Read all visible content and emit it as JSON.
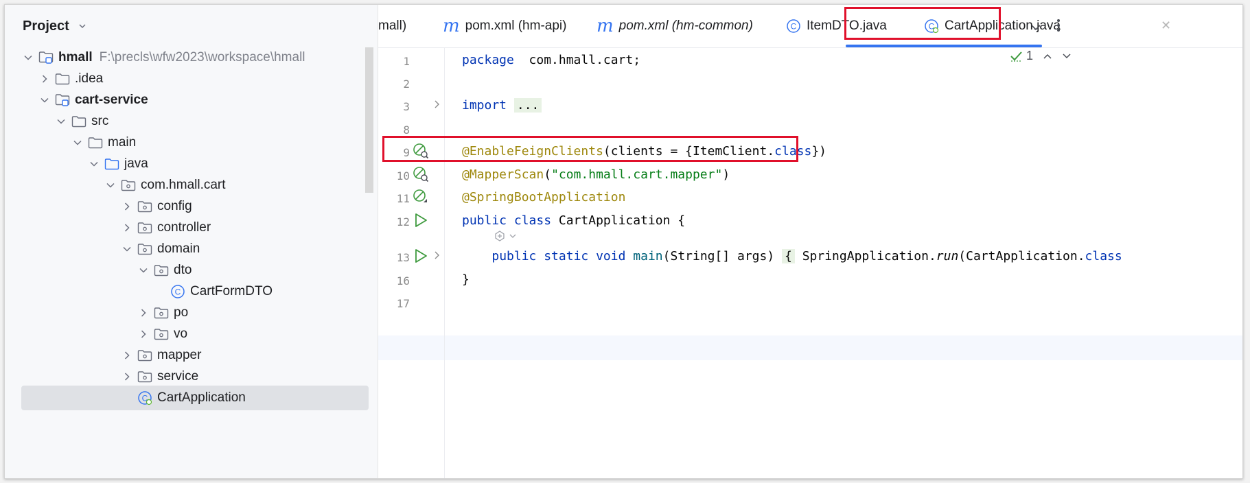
{
  "project": {
    "header": "Project",
    "tree": [
      {
        "label": "hmall",
        "path": "F:\\precls\\wfw2023\\workspace\\hmall",
        "arrow": "down",
        "icon": "module",
        "depth": 0,
        "bold": true
      },
      {
        "label": ".idea",
        "arrow": "right",
        "icon": "folder",
        "depth": 1
      },
      {
        "label": "cart-service",
        "arrow": "down",
        "icon": "module",
        "depth": 1,
        "bold": true
      },
      {
        "label": "src",
        "arrow": "down",
        "icon": "folder",
        "depth": 2
      },
      {
        "label": "main",
        "arrow": "down",
        "icon": "folder",
        "depth": 3
      },
      {
        "label": "java",
        "arrow": "down",
        "icon": "source-folder",
        "depth": 4
      },
      {
        "label": "com.hmall.cart",
        "arrow": "down",
        "icon": "package",
        "depth": 5
      },
      {
        "label": "config",
        "arrow": "right",
        "icon": "package",
        "depth": 6
      },
      {
        "label": "controller",
        "arrow": "right",
        "icon": "package",
        "depth": 6
      },
      {
        "label": "domain",
        "arrow": "down",
        "icon": "package",
        "depth": 6
      },
      {
        "label": "dto",
        "arrow": "down",
        "icon": "package",
        "depth": 7
      },
      {
        "label": "CartFormDTO",
        "arrow": "none",
        "icon": "class",
        "depth": 8
      },
      {
        "label": "po",
        "arrow": "right",
        "icon": "package",
        "depth": 7
      },
      {
        "label": "vo",
        "arrow": "right",
        "icon": "package",
        "depth": 7
      },
      {
        "label": "mapper",
        "arrow": "right",
        "icon": "package",
        "depth": 6
      },
      {
        "label": "service",
        "arrow": "right",
        "icon": "package",
        "depth": 6
      },
      {
        "label": "CartApplication",
        "arrow": "none",
        "icon": "spring-class",
        "depth": 6,
        "selected": true
      }
    ]
  },
  "tabs": [
    {
      "label": "mall)",
      "icon": "none"
    },
    {
      "label": "pom.xml (hm-api)",
      "icon": "m"
    },
    {
      "label": "pom.xml (hm-common)",
      "icon": "m",
      "italic": true
    },
    {
      "label": "ItemDTO.java",
      "icon": "class"
    },
    {
      "label": "CartApplication.java",
      "icon": "spring-class",
      "active": true
    }
  ],
  "inspection": {
    "count": "1"
  },
  "code": [
    {
      "num": "1",
      "gutter": "none",
      "html_tokens": [
        [
          "kw",
          "package"
        ],
        [
          "",
          "  com.hmall.cart;"
        ]
      ]
    },
    {
      "num": "2",
      "gutter": "none",
      "html_tokens": []
    },
    {
      "num": "3",
      "gutter": "fold",
      "html_tokens": [
        [
          "kw",
          "import"
        ],
        [
          "",
          " "
        ],
        [
          "fold",
          "..."
        ]
      ]
    },
    {
      "num": "8",
      "gutter": "none",
      "html_tokens": []
    },
    {
      "num": "9",
      "gutter": "bean",
      "html_tokens": [
        [
          "ann",
          "@EnableFeignClients"
        ],
        [
          "",
          "(clients = {ItemClient."
        ],
        [
          "kw",
          "class"
        ],
        [
          "",
          "})"
        ]
      ]
    },
    {
      "num": "10",
      "gutter": "bean",
      "html_tokens": [
        [
          "ann",
          "@MapperScan"
        ],
        [
          "",
          "("
        ],
        [
          "str",
          "\"com.hmall.cart.mapper\""
        ],
        [
          "",
          ")"
        ]
      ]
    },
    {
      "num": "11",
      "gutter": "noentry",
      "html_tokens": [
        [
          "ann",
          "@SpringBootApplication"
        ]
      ]
    },
    {
      "num": "12",
      "gutter": "run",
      "html_tokens": [
        [
          "kw",
          "public class"
        ],
        [
          "",
          " CartApplication {"
        ]
      ]
    },
    {
      "num": "13",
      "gutter": "run-fold",
      "html_tokens": [
        [
          "",
          "    "
        ],
        [
          "kw",
          "public static void"
        ],
        [
          "",
          " "
        ],
        [
          "fn",
          "main"
        ],
        [
          "",
          "(String[] args) "
        ],
        [
          "fold",
          "{"
        ],
        [
          "",
          " SpringApplication."
        ],
        [
          "it",
          "run"
        ],
        [
          "",
          "(CartApplication."
        ],
        [
          "kw",
          "class"
        ]
      ]
    },
    {
      "num": "16",
      "gutter": "none",
      "html_tokens": [
        [
          "",
          "}"
        ]
      ]
    },
    {
      "num": "17",
      "gutter": "none",
      "html_tokens": []
    }
  ]
}
